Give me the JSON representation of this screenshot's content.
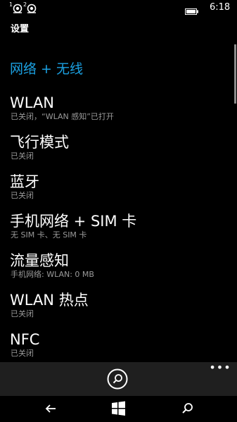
{
  "status_bar": {
    "sim1": "1",
    "sim2": "2",
    "time": "6:18"
  },
  "header": {
    "app_title": "设置",
    "section_title": "网络 + 无线"
  },
  "settings": [
    {
      "name": "WLAN",
      "status": "已关闭，“WLAN 感知”已打开"
    },
    {
      "name": "飞行模式",
      "status": "已关闭"
    },
    {
      "name": "蓝牙",
      "status": "已关闭"
    },
    {
      "name": "手机网络 + SIM 卡",
      "status": "无 SIM 卡、无 SIM 卡"
    },
    {
      "name": "流量感知",
      "status": "手机网络: WLAN: 0 MB"
    },
    {
      "name": "WLAN 热点",
      "status": "已关闭"
    },
    {
      "name": "NFC",
      "status": "已关闭"
    }
  ],
  "app_bar": {
    "more": "•••",
    "search_icon": "search-icon"
  },
  "nav_bar": {
    "icons": [
      "back-arrow-icon",
      "windows-start-icon",
      "search-icon"
    ]
  },
  "colors": {
    "accent": "#1ba1e2",
    "background": "#000000",
    "secondary_text": "#9a9a9a",
    "app_bar": "#1f1f1f"
  }
}
